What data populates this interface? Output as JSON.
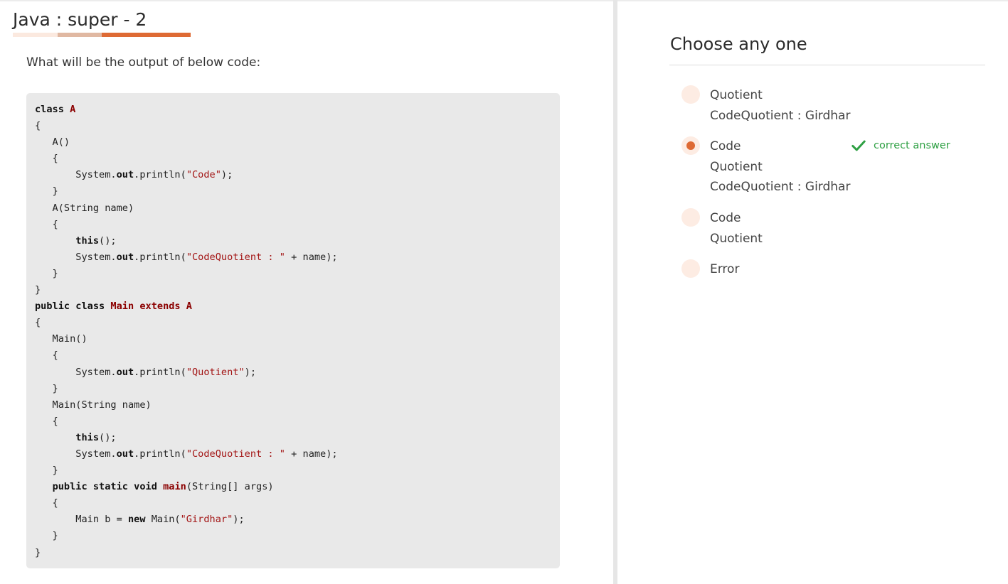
{
  "question": {
    "title": "Java : super - 2",
    "prompt": "What will be the output of below code:",
    "code_lines": [
      [
        {
          "t": "class",
          "c": "kw"
        },
        {
          "t": " "
        },
        {
          "t": "A",
          "c": "cls"
        }
      ],
      [
        {
          "t": "{"
        }
      ],
      [
        {
          "t": "   A()"
        }
      ],
      [
        {
          "t": "   {"
        }
      ],
      [
        {
          "t": "       System."
        },
        {
          "t": "out",
          "c": "b"
        },
        {
          "t": ".println("
        },
        {
          "t": "\"Code\"",
          "c": "str"
        },
        {
          "t": ");"
        }
      ],
      [
        {
          "t": "   }"
        }
      ],
      [
        {
          "t": "   A(String name)"
        }
      ],
      [
        {
          "t": "   {"
        }
      ],
      [
        {
          "t": "       "
        },
        {
          "t": "this",
          "c": "kw"
        },
        {
          "t": "();"
        }
      ],
      [
        {
          "t": "       System."
        },
        {
          "t": "out",
          "c": "b"
        },
        {
          "t": ".println("
        },
        {
          "t": "\"CodeQuotient : \"",
          "c": "str"
        },
        {
          "t": " + name);"
        }
      ],
      [
        {
          "t": "   }"
        }
      ],
      [
        {
          "t": "}"
        }
      ],
      [
        {
          "t": "public class",
          "c": "kw"
        },
        {
          "t": " "
        },
        {
          "t": "Main extends A",
          "c": "cls"
        }
      ],
      [
        {
          "t": "{"
        }
      ],
      [
        {
          "t": "   Main()"
        }
      ],
      [
        {
          "t": "   {"
        }
      ],
      [
        {
          "t": "       System."
        },
        {
          "t": "out",
          "c": "b"
        },
        {
          "t": ".println("
        },
        {
          "t": "\"Quotient\"",
          "c": "str"
        },
        {
          "t": ");"
        }
      ],
      [
        {
          "t": "   }"
        }
      ],
      [
        {
          "t": "   Main(String name)"
        }
      ],
      [
        {
          "t": "   {"
        }
      ],
      [
        {
          "t": "       "
        },
        {
          "t": "this",
          "c": "kw"
        },
        {
          "t": "();"
        }
      ],
      [
        {
          "t": "       System."
        },
        {
          "t": "out",
          "c": "b"
        },
        {
          "t": ".println("
        },
        {
          "t": "\"CodeQuotient : \"",
          "c": "str"
        },
        {
          "t": " + name);"
        }
      ],
      [
        {
          "t": "   }"
        }
      ],
      [
        {
          "t": "   "
        },
        {
          "t": "public static void",
          "c": "kw"
        },
        {
          "t": " "
        },
        {
          "t": "main",
          "c": "cls"
        },
        {
          "t": "(String[] args)"
        }
      ],
      [
        {
          "t": "   {"
        }
      ],
      [
        {
          "t": "       Main b = "
        },
        {
          "t": "new",
          "c": "kw"
        },
        {
          "t": " Main("
        },
        {
          "t": "\"Girdhar\"",
          "c": "str"
        },
        {
          "t": ");"
        }
      ],
      [
        {
          "t": "   }"
        }
      ],
      [
        {
          "t": "}"
        }
      ]
    ]
  },
  "answers": {
    "heading": "Choose any one",
    "correct_label": "correct answer",
    "correct_icon": "check-icon",
    "colors": {
      "accent": "#de6a34",
      "radio_bg": "#fdece3",
      "correct": "#2ea043"
    },
    "options": [
      {
        "lines": [
          "Quotient",
          "CodeQuotient : Girdhar"
        ],
        "selected": false,
        "correct": false
      },
      {
        "lines": [
          "Code",
          "Quotient",
          "CodeQuotient : Girdhar"
        ],
        "selected": true,
        "correct": true
      },
      {
        "lines": [
          "Code",
          "Quotient"
        ],
        "selected": false,
        "correct": false
      },
      {
        "lines": [
          "Error"
        ],
        "selected": false,
        "correct": false
      }
    ]
  }
}
